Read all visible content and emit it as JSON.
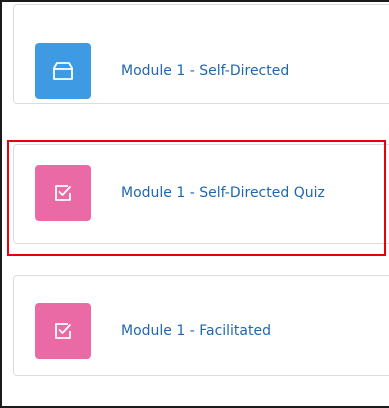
{
  "activities": [
    {
      "name": "Module 1 - Self-Directed",
      "icon": "package-icon",
      "tile_color": "#3f9ae4"
    },
    {
      "name": "Module 1 - Self-Directed Quiz",
      "icon": "quiz-checkbox-icon",
      "tile_color": "#ea6aa6"
    },
    {
      "name": "Module 1 - Facilitated",
      "icon": "quiz-checkbox-icon",
      "tile_color": "#ea6aa6"
    }
  ],
  "highlight_color": "#e8000b",
  "link_color": "#1f67b0"
}
